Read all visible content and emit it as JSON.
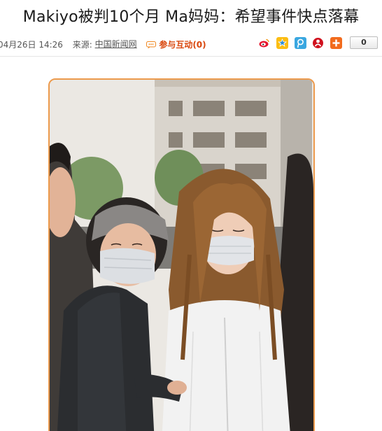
{
  "article": {
    "headline": "Makiyo被判10个月 Ma妈妈：希望事件快点落幕",
    "date": "04月26日 14:26",
    "source_label": "来源:",
    "source_name": "中国新闻网",
    "comment_link": "参与互动(0)"
  },
  "share": {
    "icons": [
      "weibo-icon",
      "qzone-icon",
      "tencent-weibo-icon",
      "renren-icon",
      "more-share-icon"
    ],
    "count": "0"
  },
  "photo": {
    "description_icon": "news-photo"
  },
  "colors": {
    "accent": "#d9460c",
    "frame": "#ec9a4c",
    "headline": "#1a1a1a"
  }
}
